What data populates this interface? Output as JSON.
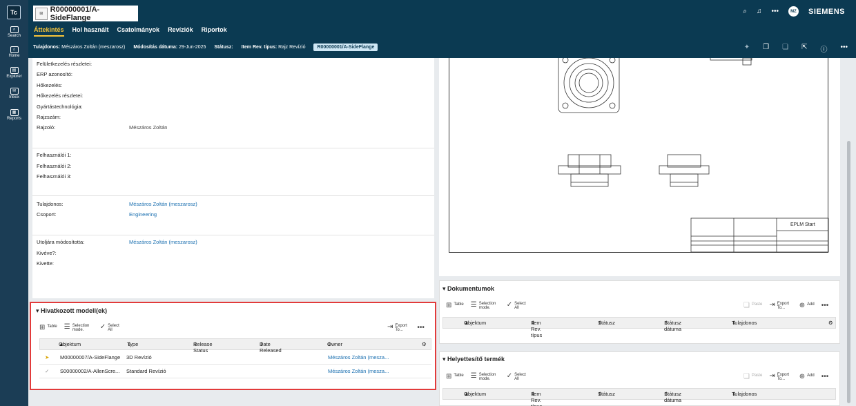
{
  "rail": {
    "logo": "Tc",
    "items": [
      {
        "label": "Search",
        "icon": "search-icon"
      },
      {
        "label": "Home",
        "icon": "home-icon"
      },
      {
        "label": "Explorer",
        "icon": "explorer-icon"
      },
      {
        "label": "Inbox",
        "icon": "inbox-icon"
      },
      {
        "label": "Reports",
        "icon": "reports-icon"
      }
    ]
  },
  "header": {
    "title": "R00000001/A-SideFlange",
    "avatar": "MZ",
    "brand": "SIEMENS",
    "tabs": [
      "Áttekintés",
      "Hol használt",
      "Csatolmányok",
      "Revíziók",
      "Riportok"
    ],
    "meta": {
      "owner_label": "Tulajdonos:",
      "owner_value": "Mészáros Zoltán (meszarosz)",
      "modified_label": "Módosítás dátuma:",
      "modified_value": "29-Jun-2025",
      "status_label": "Státusz:",
      "status_value": "",
      "revtype_label": "Item Rev. típus:",
      "revtype_value": "Rajz Revízió",
      "pill": "R00000001/A-SideFlange"
    }
  },
  "properties": {
    "group1": [
      {
        "label": "Felületkezelés részletei:",
        "value": ""
      },
      {
        "label": "ERP azonosító:",
        "value": ""
      },
      {
        "label": "Hőkezelés:",
        "value": ""
      },
      {
        "label": "Hőkezelés részletei:",
        "value": ""
      },
      {
        "label": "Gyártástechnológia:",
        "value": ""
      },
      {
        "label": "Rajzszám:",
        "value": ""
      },
      {
        "label": "Rajzoló:",
        "value": "Mészáros Zoltán"
      }
    ],
    "group2": [
      {
        "label": "Felhasználói 1:",
        "value": ""
      },
      {
        "label": "Felhasználói 2:",
        "value": ""
      },
      {
        "label": "Felhasználói 3:",
        "value": ""
      }
    ],
    "group3": [
      {
        "label": "Tulajdonos:",
        "value": "Mészáros Zoltán (meszarosz)"
      },
      {
        "label": "Csoport:",
        "value": "Engineering"
      }
    ],
    "group4": [
      {
        "label": "Utoljára módosította:",
        "value": "Mészáros Zoltán (meszarosz)"
      },
      {
        "label": "Kivéve?:",
        "value": ""
      },
      {
        "label": "Kivette:",
        "value": ""
      }
    ]
  },
  "ref_models": {
    "title": "Hivatkozott modell(ek)",
    "toolbar": {
      "table": "Table",
      "selection": "Selection mode.",
      "select_all": "Select All",
      "export": "Export To..."
    },
    "columns": [
      "Objektum",
      "Type",
      "Release Status",
      "Date Released",
      "Owner"
    ],
    "rows": [
      {
        "objektum": "M00000007/A-SideFlange",
        "type": "3D Revízió",
        "release": "",
        "date": "",
        "owner": "Mészáros Zoltán (mesza..."
      },
      {
        "objektum": "S00000002/A-AllenScre...",
        "type": "Standard Revízió",
        "release": "",
        "date": "",
        "owner": "Mészáros Zoltán (mesza..."
      }
    ]
  },
  "drawing": {
    "title_block": "EPLM Start"
  },
  "documents": {
    "title": "Dokumentumok",
    "toolbar": {
      "table": "Table",
      "selection": "Selection mode.",
      "select_all": "Select All",
      "paste": "Paste",
      "export": "Export To...",
      "add": "Add"
    },
    "columns": [
      "Objektum",
      "Item Rev. típus",
      "Státusz",
      "Státusz dátuma",
      "Tulajdonos"
    ]
  },
  "substitutes": {
    "title": "Helyettesítő termék",
    "toolbar": {
      "table": "Table",
      "selection": "Selection mode.",
      "select_all": "Select All",
      "paste": "Paste",
      "export": "Export To...",
      "add": "Add"
    },
    "columns": [
      "Objektum",
      "Item Rev. típus",
      "Státusz",
      "Státusz dátuma",
      "Tulajdonos"
    ]
  }
}
